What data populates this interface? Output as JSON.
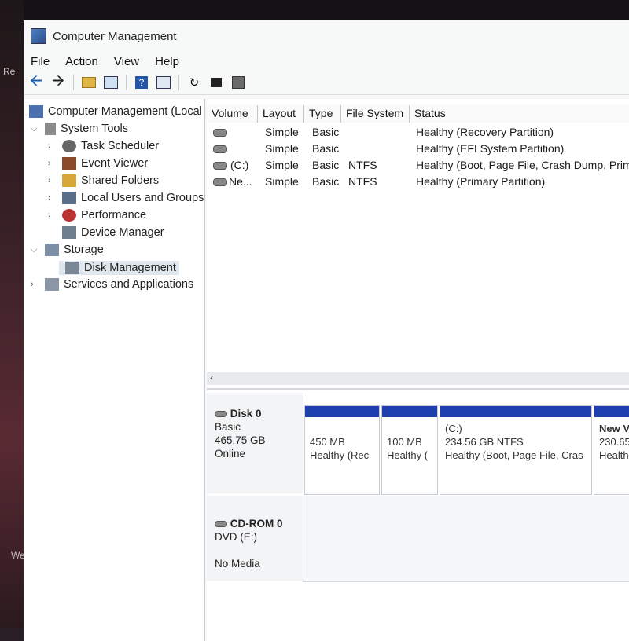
{
  "window": {
    "title": "Computer Management"
  },
  "menu": [
    "File",
    "Action",
    "View",
    "Help"
  ],
  "tree": {
    "root": "Computer Management (Local",
    "system_tools": "System Tools",
    "task_scheduler": "Task Scheduler",
    "event_viewer": "Event Viewer",
    "shared_folders": "Shared Folders",
    "local_users": "Local Users and Groups",
    "performance": "Performance",
    "device_manager": "Device Manager",
    "storage": "Storage",
    "disk_management": "Disk Management",
    "services": "Services and Applications"
  },
  "volume_table": {
    "headers": [
      "Volume",
      "Layout",
      "Type",
      "File System",
      "Status"
    ],
    "rows": [
      {
        "volume": "",
        "layout": "Simple",
        "type": "Basic",
        "fs": "",
        "status": "Healthy (Recovery Partition)"
      },
      {
        "volume": "",
        "layout": "Simple",
        "type": "Basic",
        "fs": "",
        "status": "Healthy (EFI System Partition)"
      },
      {
        "volume": "(C:)",
        "layout": "Simple",
        "type": "Basic",
        "fs": "NTFS",
        "status": "Healthy (Boot, Page File, Crash Dump, Prim"
      },
      {
        "volume": "Ne...",
        "layout": "Simple",
        "type": "Basic",
        "fs": "NTFS",
        "status": "Healthy (Primary Partition)"
      }
    ]
  },
  "disk0": {
    "name": "Disk 0",
    "type": "Basic",
    "size": "465.75 GB",
    "state": "Online",
    "partitions": [
      {
        "title": "",
        "size": "450 MB",
        "status": "Healthy (Rec"
      },
      {
        "title": "",
        "size": "100 MB",
        "status": "Healthy ("
      },
      {
        "title": "(C:)",
        "size": "234.56 GB NTFS",
        "status": "Healthy (Boot, Page File, Cras"
      },
      {
        "title": "New V",
        "size": "230.65",
        "status": "Health"
      }
    ]
  },
  "cdrom": {
    "name": "CD-ROM 0",
    "type": "DVD (E:)",
    "media": "No Media"
  },
  "desktop": {
    "left_a": "Re",
    "left_b": "We"
  },
  "colors": {
    "partition_bar": "#1f3fae"
  }
}
